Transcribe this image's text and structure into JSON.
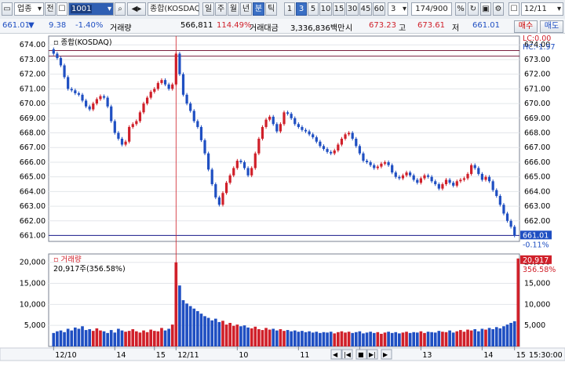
{
  "toolbar": {
    "market_select": "업종",
    "prev_label": "전",
    "code": "1001",
    "search_icon": "search-icon",
    "name": "종합(KOSDAQ)",
    "periods": [
      "일",
      "주",
      "월",
      "년",
      "분",
      "틱"
    ],
    "active_period": "분",
    "intervals": [
      "1",
      "3",
      "5",
      "10",
      "15",
      "30",
      "45",
      "60"
    ],
    "active_interval": "3",
    "interval_value": "3",
    "count": "174/900",
    "date": "12/11"
  },
  "info": {
    "price": "661.01",
    "change": "9.38",
    "change_pct": "-1.40%",
    "volume_label": "거래량",
    "volume": "566,811",
    "volume_ratio": "114.49%",
    "amount_label": "거래대금",
    "amount": "3,336,836백만",
    "open_label": "시",
    "open": "673.23",
    "high_label": "고",
    "high": "673.61",
    "low_label": "저",
    "low": "661.01",
    "buy_button": "매수",
    "sell_button": "매도"
  },
  "price_panel": {
    "legend": "종합(KOSDAQ)",
    "lc_label": "LC:0.00",
    "hc_label": "HC:-1.97",
    "last_price_tag": "661.01",
    "last_pct_tag": "-0.11%",
    "colors": {
      "up": "#d0202a",
      "down": "#1f4fc2",
      "grid": "#e3e6ea",
      "line": "#1a1a8c"
    }
  },
  "volume_panel": {
    "legend": "거래량",
    "current": "20,917주(356.58%)",
    "last_volume_tag": "20,917",
    "last_pct_tag": "356.58%"
  },
  "chart_data": [
    {
      "type": "candlestick",
      "title": "종합(KOSDAQ)",
      "ylim": [
        660.6,
        674.6
      ],
      "yticks": [
        "674.00",
        "673.00",
        "672.00",
        "671.00",
        "670.00",
        "669.00",
        "668.00",
        "667.00",
        "666.00",
        "665.00",
        "664.00",
        "663.00",
        "662.00",
        "661.00"
      ],
      "close": [
        673.4,
        673.1,
        672.6,
        671.8,
        671.0,
        670.9,
        670.7,
        670.6,
        670.2,
        669.8,
        669.6,
        670.0,
        670.3,
        670.5,
        670.4,
        669.8,
        668.8,
        668.0,
        667.6,
        667.2,
        667.4,
        668.4,
        668.6,
        668.8,
        669.4,
        670.0,
        670.4,
        670.8,
        671.0,
        671.4,
        671.6,
        671.3,
        671.0,
        671.3,
        673.4,
        672.0,
        670.6,
        670.0,
        669.5,
        668.8,
        668.4,
        667.5,
        666.6,
        665.5,
        664.5,
        663.6,
        663.1,
        663.9,
        664.6,
        665.1,
        665.6,
        666.1,
        666.0,
        665.6,
        665.1,
        665.6,
        666.6,
        667.6,
        668.4,
        668.9,
        669.1,
        668.6,
        668.1,
        668.6,
        669.4,
        669.3,
        669.0,
        668.6,
        668.4,
        668.2,
        668.1,
        667.9,
        667.7,
        667.4,
        667.1,
        666.9,
        666.7,
        666.6,
        666.8,
        667.2,
        667.6,
        667.9,
        668.0,
        667.6,
        667.1,
        666.6,
        666.1,
        666.0,
        665.8,
        665.6,
        665.7,
        665.9,
        666.0,
        665.8,
        665.3,
        665.0,
        664.9,
        665.1,
        665.3,
        665.1,
        664.8,
        664.6,
        664.9,
        665.1,
        665.0,
        664.7,
        664.5,
        664.2,
        664.5,
        664.8,
        664.6,
        664.4,
        664.7,
        664.8,
        664.9,
        665.2,
        665.8,
        665.6,
        665.2,
        664.8,
        665.0,
        664.7,
        664.1,
        663.7,
        663.1,
        662.5,
        662.0,
        661.6,
        661.0
      ],
      "x_tick_labels": [
        "12/10",
        "14",
        "15",
        "12/11",
        "10",
        "11",
        "12",
        "13",
        "14",
        "15"
      ],
      "hlines": [
        673.23,
        673.61,
        661.01
      ],
      "vline_index": 34
    },
    {
      "type": "bar",
      "title": "거래량",
      "ylim": [
        0,
        22000
      ],
      "yticks": [
        "20,000",
        "15,000",
        "10,000",
        "5,000"
      ],
      "values": [
        3200,
        3600,
        3800,
        3400,
        4200,
        3800,
        4500,
        4200,
        4800,
        3900,
        4100,
        3700,
        4300,
        3800,
        3600,
        3200,
        3900,
        3300,
        4200,
        3800,
        3500,
        3700,
        4100,
        3600,
        3300,
        3800,
        3400,
        4000,
        3700,
        3600,
        4400,
        3800,
        4200,
        5200,
        20000,
        14500,
        11000,
        10200,
        9600,
        9000,
        8400,
        7800,
        7200,
        6800,
        6200,
        6600,
        5800,
        6100,
        5200,
        5600,
        4900,
        5200,
        4800,
        5000,
        4500,
        4300,
        4700,
        4100,
        3900,
        4400,
        4000,
        4200,
        3800,
        4100,
        3700,
        3900,
        3600,
        3800,
        3500,
        3700,
        3400,
        3600,
        3300,
        3500,
        3200,
        3400,
        3300,
        3500,
        3100,
        3400,
        3600,
        3300,
        3500,
        3200,
        3400,
        3600,
        3100,
        3300,
        3500,
        3200,
        3400,
        3000,
        3300,
        3500,
        3200,
        3400,
        3100,
        3300,
        3500,
        3200,
        3400,
        3300,
        3600,
        3200,
        3500,
        3400,
        3300,
        3700,
        3500,
        3400,
        3800,
        3300,
        3600,
        3900,
        3500,
        4000,
        3800,
        4100,
        3600,
        4200,
        4000,
        4400,
        4100,
        4600,
        4300,
        4800,
        5200,
        5600,
        6000,
        20917
      ],
      "x_tick_labels": [
        "12/10",
        "14",
        "15",
        "12/11",
        "10",
        "11",
        "12",
        "13",
        "14",
        "15"
      ]
    }
  ],
  "time_axis": {
    "right_label": "15:30:00"
  },
  "scroll": {
    "zoom_out": "+",
    "zoom_in": "-"
  }
}
